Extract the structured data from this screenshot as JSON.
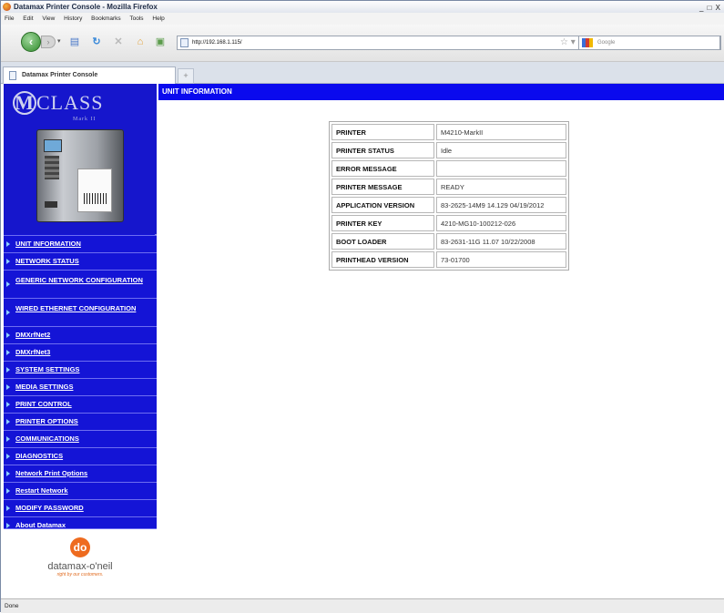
{
  "window": {
    "title": "Datamax Printer Console - Mozilla Firefox",
    "controls": "_ □ X"
  },
  "menubar": [
    "File",
    "Edit",
    "View",
    "History",
    "Bookmarks",
    "Tools",
    "Help"
  ],
  "toolbar": {
    "url": "http://192.168.1.115/",
    "search_placeholder": "Google"
  },
  "tab": {
    "label": "Datamax Printer Console",
    "new_tab": "+"
  },
  "sidebar": {
    "logo": {
      "letter": "M",
      "word": "CLASS",
      "sub": "Mark II"
    },
    "items": [
      {
        "label": "UNIT INFORMATION",
        "lines": 1
      },
      {
        "label": "NETWORK STATUS",
        "lines": 1
      },
      {
        "label": "GENERIC NETWORK CONFIGURATION",
        "lines": 2
      },
      {
        "label": "WIRED ETHERNET CONFIGURATION",
        "lines": 2
      },
      {
        "label": "DMXrfNet2",
        "lines": 1
      },
      {
        "label": "DMXrfNet3",
        "lines": 1
      },
      {
        "label": "SYSTEM SETTINGS",
        "lines": 1
      },
      {
        "label": "MEDIA SETTINGS",
        "lines": 1
      },
      {
        "label": "PRINT CONTROL",
        "lines": 1
      },
      {
        "label": "PRINTER OPTIONS",
        "lines": 1
      },
      {
        "label": "COMMUNICATIONS",
        "lines": 1
      },
      {
        "label": "DIAGNOSTICS",
        "lines": 1
      },
      {
        "label": "Network Print Options",
        "lines": 1
      },
      {
        "label": "Restart Network",
        "lines": 1
      },
      {
        "label": "MODIFY PASSWORD",
        "lines": 1
      },
      {
        "label": "About Datamax",
        "lines": 1
      }
    ],
    "brand": {
      "mark": "do",
      "name": "datamax-o'neil",
      "tagline": "right by our customers."
    }
  },
  "content": {
    "header": "UNIT INFORMATION",
    "rows": [
      {
        "key": "PRINTER",
        "value": "M4210-MarkII"
      },
      {
        "key": "PRINTER STATUS",
        "value": "Idle"
      },
      {
        "key": "ERROR MESSAGE",
        "value": ""
      },
      {
        "key": "PRINTER MESSAGE",
        "value": "READY"
      },
      {
        "key": "APPLICATION VERSION",
        "value": "83-2625-14M9 14.129 04/19/2012"
      },
      {
        "key": "PRINTER KEY",
        "value": "4210-MG10-100212-026"
      },
      {
        "key": "BOOT LOADER",
        "value": "83-2631-11G 11.07 10/22/2008"
      },
      {
        "key": "PRINTHEAD VERSION",
        "value": "73-01700"
      }
    ]
  },
  "status": "Done"
}
